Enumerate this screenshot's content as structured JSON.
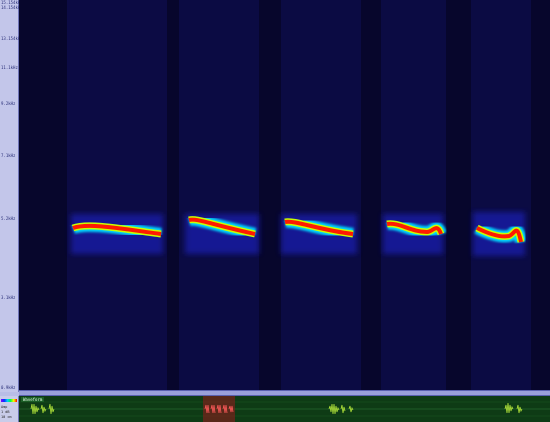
{
  "frequency_axis": {
    "ticks": [
      "15.154kHz",
      "14.154kHz",
      "13.154kHz",
      "11.1kHz",
      "9.2kHz",
      "7.1kHz",
      "5.2kHz",
      "3.1kHz",
      "0.9kHz"
    ]
  },
  "waveform_panel": {
    "title": "Waveform"
  },
  "side_panel": {
    "labels": [
      "Amp",
      "1 dB",
      "10 cm"
    ]
  },
  "colors": {
    "background": "#07062c",
    "waveform_bg": "#0e3b15",
    "waveform_line": "#b4e63a",
    "selection": "#c0392b"
  }
}
